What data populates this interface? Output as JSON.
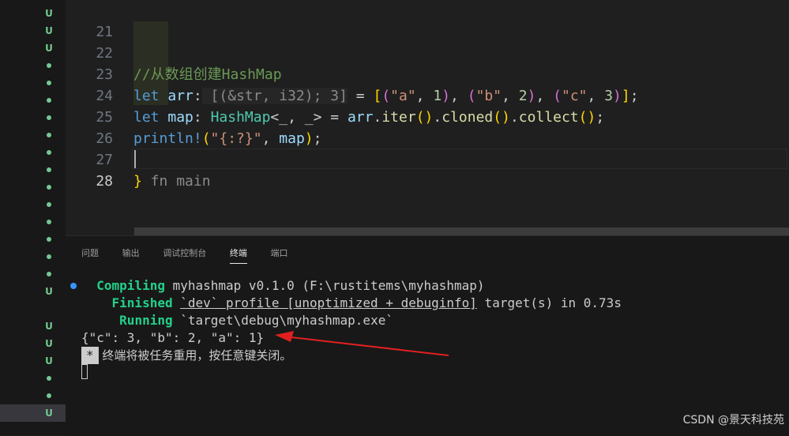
{
  "scm_gutter": {
    "markers": [
      "U",
      "U",
      "U",
      "dot",
      "dot",
      "dot",
      "dot",
      "dot",
      "dot",
      "dot",
      "dot",
      "dot",
      "dot",
      "dot",
      "dot",
      "dot",
      "U",
      "",
      "U",
      "U",
      "U",
      "dot",
      "dot",
      "U"
    ]
  },
  "editor": {
    "lines": [
      {
        "num": "21"
      },
      {
        "num": "22",
        "comment": "//从数组创建HashMap"
      },
      {
        "num": "23",
        "kw": "let",
        "var": "arr",
        "colon": ":",
        "hint": " [(&str, i32); 3]",
        "eq": " = ",
        "tok1": "[",
        "tok2": "(",
        "s1": "\"a\"",
        "c1": ", ",
        "n1": "1",
        "tok3": ")",
        "c2": ", ",
        "tok4": "(",
        "s2": "\"b\"",
        "c3": ", ",
        "n2": "2",
        "tok5": ")",
        "c4": ", ",
        "tok6": "(",
        "s3": "\"c\"",
        "c5": ", ",
        "n3": "3",
        "tok7": ")",
        "tok8": "]",
        "semi": ";"
      },
      {
        "num": "24",
        "kw": "let",
        "var": "map",
        "colon": ": ",
        "type": "HashMap",
        "generic": "<_, _>",
        "eq": " = ",
        "recv": "arr",
        "dot1": ".",
        "m1": "iter",
        "pp1": "()",
        "dot2": ".",
        "m2": "cloned",
        "pp2": "()",
        "dot3": ".",
        "m3": "collect",
        "pp3": "()",
        "semi": ";"
      },
      {
        "num": "25",
        "macro": "println!",
        "open": "(",
        "fmt": "\"{:?}\"",
        "comma": ", ",
        "arg": "map",
        "close": ")",
        "semi": ";"
      },
      {
        "num": "26"
      },
      {
        "num": "27",
        "brace": "}",
        "fold": " fn main"
      },
      {
        "num": "28"
      }
    ]
  },
  "panel": {
    "tabs": [
      "问题",
      "输出",
      "调试控制台",
      "终端",
      "端口"
    ],
    "active_tab": "终端",
    "terminal": {
      "compiling_label": "Compiling",
      "compiling_text": " myhashmap v0.1.0 (F:\\rustitems\\myhashmap)",
      "finished_label": "Finished",
      "finished_profile": "`dev` profile [unoptimized + debuginfo]",
      "finished_rest": " target(s) in 0.73s",
      "running_label": "Running",
      "running_text": " `target\\debug\\myhashmap.exe`",
      "output": "{\"c\": 3, \"b\": 2, \"a\": 1}",
      "star": "*",
      "reuse_msg": " 终端将被任务重用，按任意键关闭。"
    }
  },
  "watermark": "CSDN @景天科技苑",
  "colors": {
    "background": "#1f1f1f",
    "scm_added": "#73c991",
    "terminal_green": "#23d18b",
    "annotation_arrow": "#e02020"
  }
}
